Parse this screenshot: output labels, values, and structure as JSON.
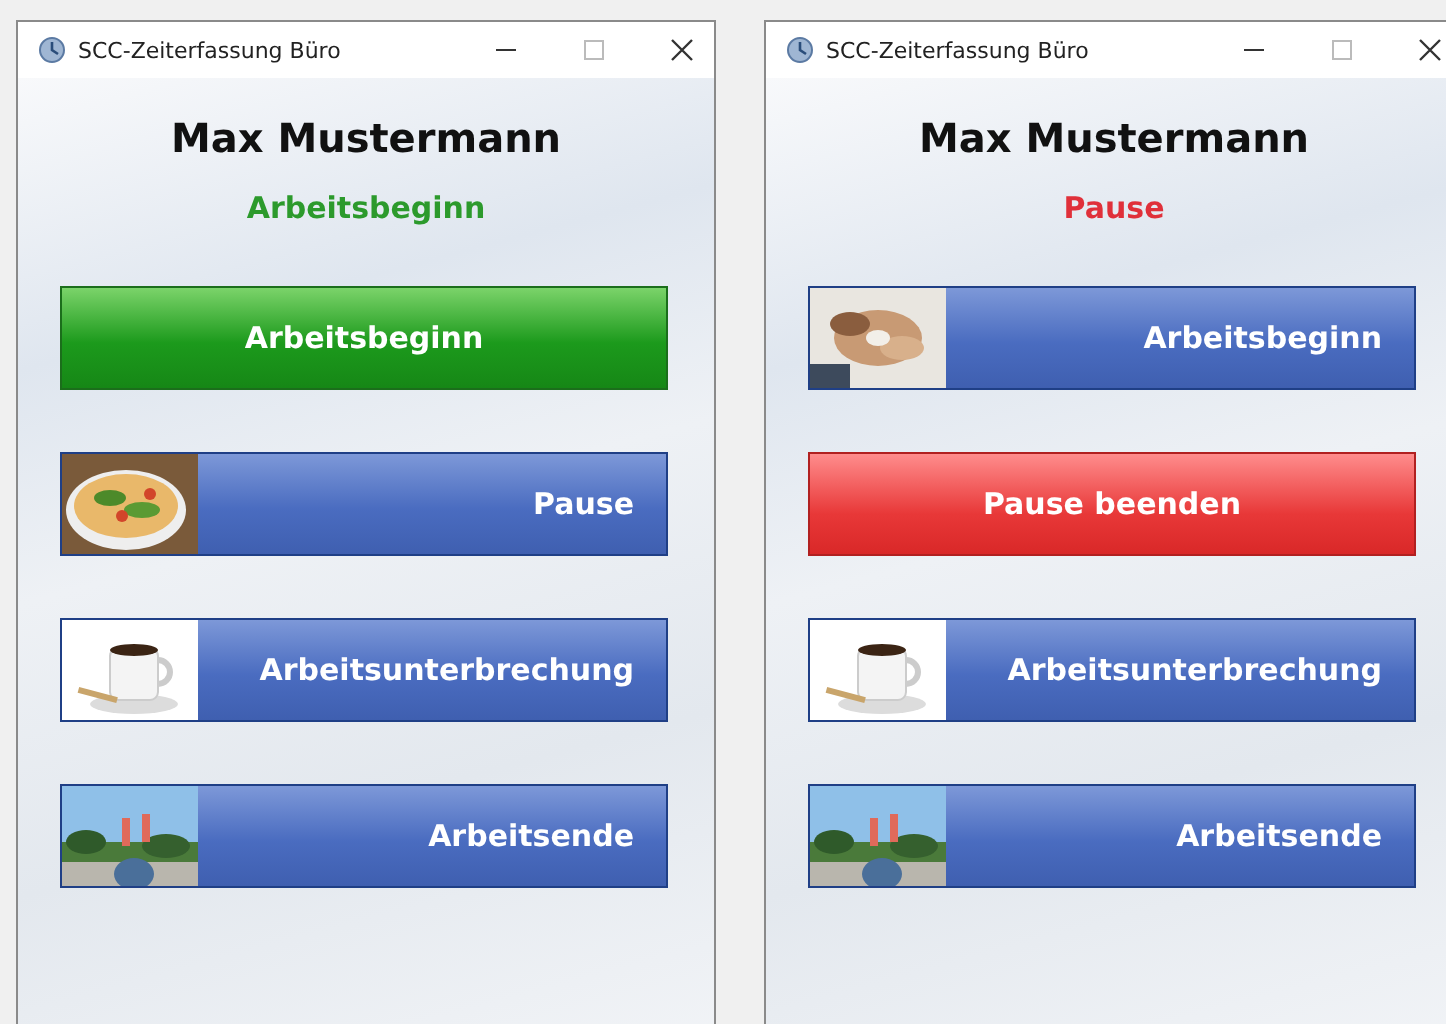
{
  "windows": [
    {
      "title": "SCC-Zeiterfassung Büro",
      "person": "Max Mustermann",
      "status": {
        "text": "Arbeitsbeginn",
        "kind": "working"
      },
      "buttons": [
        {
          "label": "Arbeitsbeginn",
          "kind": "active_start"
        },
        {
          "label": "Pause"
        },
        {
          "label": "Arbeitsunterbrechung"
        },
        {
          "label": "Arbeitsende"
        }
      ]
    },
    {
      "title": "SCC-Zeiterfassung Büro",
      "person": "Max Mustermann",
      "status": {
        "text": "Pause",
        "kind": "pause"
      },
      "buttons": [
        {
          "label": "Arbeitsbeginn"
        },
        {
          "label": "Pause beenden",
          "kind": "active_stop"
        },
        {
          "label": "Arbeitsunterbrechung"
        },
        {
          "label": "Arbeitsende"
        }
      ]
    }
  ]
}
